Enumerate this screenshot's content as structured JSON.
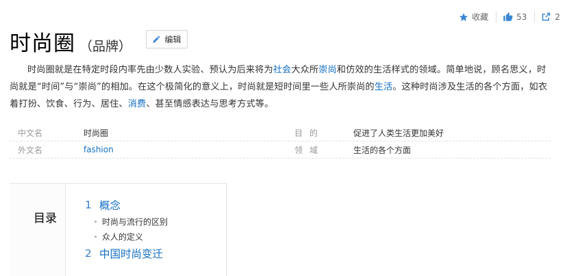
{
  "actions": {
    "collect_label": "收藏",
    "like_count": "53",
    "share_count": "2"
  },
  "header": {
    "title": "时尚圈",
    "subtitle": "（品牌）",
    "edit_label": "编辑"
  },
  "summary": {
    "p1": "时尚圈就是在特定时段内率先由少数人实验、预认为后来将为",
    "link1": "社会",
    "p2": "大众所",
    "link2": "崇尚",
    "p3": "和仿效的生活样式的领域。简单地说，顾名思义，时尚就是“时间”与“崇尚”的相加。在这个极简化的意义上，时尚就是短时间里一些人所崇尚的",
    "link3": "生活",
    "p4": "。这种时尚涉及生活的各个方面，如衣着打扮、饮食、行为、居住、",
    "link4": "消费",
    "p5": "、甚至情感表达与思考方式等。"
  },
  "basic_info": {
    "rows": [
      {
        "name1": "中文名",
        "value1": "时尚圈",
        "name2": "目的",
        "value2": "促进了人类生活更加美好"
      },
      {
        "name1": "外文名",
        "value1": "fashion",
        "name2": "领域",
        "value2": "生活的各个方面"
      }
    ]
  },
  "catalog": {
    "title": "目录",
    "items": [
      {
        "index": "1",
        "label": "概念"
      },
      {
        "index": "2",
        "label": "中国时尚变迁"
      }
    ],
    "subitems": [
      "时尚与流行的区别",
      "众人的定义"
    ]
  },
  "colors": {
    "link": "#136ec2",
    "icon_blue": "#3a86d4"
  }
}
